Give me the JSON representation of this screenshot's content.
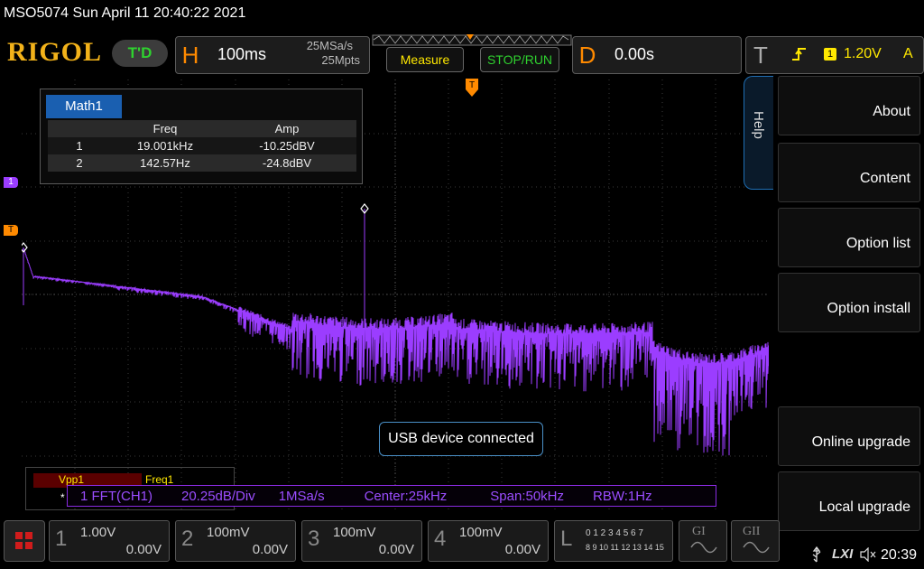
{
  "header": {
    "title": "MSO5074  Sun April 11 20:40:22 2021",
    "logo": "RIGOL",
    "td_badge": "T'D",
    "h_label": "H",
    "h_timebase": "100ms",
    "h_sample_rate": "25MSa/s",
    "h_memory_depth": "25Mpts",
    "measure_label": "Measure",
    "stop_run_label": "STOP/RUN",
    "d_label": "D",
    "d_delay": "0.00s",
    "t_label": "T",
    "trigger_level": "1.20V",
    "trigger_mode": "A",
    "trigger_source": "1"
  },
  "math_window": {
    "tab": "Math1",
    "columns": [
      "",
      "Freq",
      "Amp"
    ],
    "rows": [
      [
        "1",
        "19.001kHz",
        "-10.25dBV"
      ],
      [
        "2",
        "142.57Hz",
        "-24.8dBV"
      ]
    ]
  },
  "markers": {
    "ch1": "1",
    "trigger": "T"
  },
  "usb_message": "USB device connected",
  "measure_strip": {
    "vpp": "Vpp1",
    "freq": "Freq1",
    "star": "*"
  },
  "fft_bar": {
    "source": "1 FFT(CH1)",
    "scale": "20.25dB/Div",
    "rate": "1MSa/s",
    "center": "Center:25kHz",
    "span": "Span:50kHz",
    "rbw": "RBW:1Hz"
  },
  "help_tab": "Help",
  "side_menu": [
    {
      "label": "About"
    },
    {
      "label": "Content"
    },
    {
      "label": "Option list"
    },
    {
      "label": "Option install"
    },
    {
      "label": "Online upgrade"
    },
    {
      "label": "Local upgrade"
    }
  ],
  "channels": [
    {
      "num": "1",
      "volts": "1.00V",
      "offset": "0.00V"
    },
    {
      "num": "2",
      "volts": "100mV",
      "offset": "0.00V"
    },
    {
      "num": "3",
      "volts": "100mV",
      "offset": "0.00V"
    },
    {
      "num": "4",
      "volts": "100mV",
      "offset": "0.00V"
    }
  ],
  "logic": {
    "label": "L",
    "row1": "0 1 2 3  4 5 6 7",
    "row2": "8 9 10 11  12 13 14 15"
  },
  "generators": {
    "g1": "GI",
    "g2": "GII"
  },
  "status": {
    "lxi": "LXI",
    "time": "20:39"
  },
  "colors": {
    "math_trace": "#9b3dff",
    "accent_orange": "#ff8a00",
    "logo_gold": "#f2b21a",
    "run_green": "#2fd22f",
    "yellow": "#ffe800",
    "help_blue": "#1f6fb5"
  }
}
